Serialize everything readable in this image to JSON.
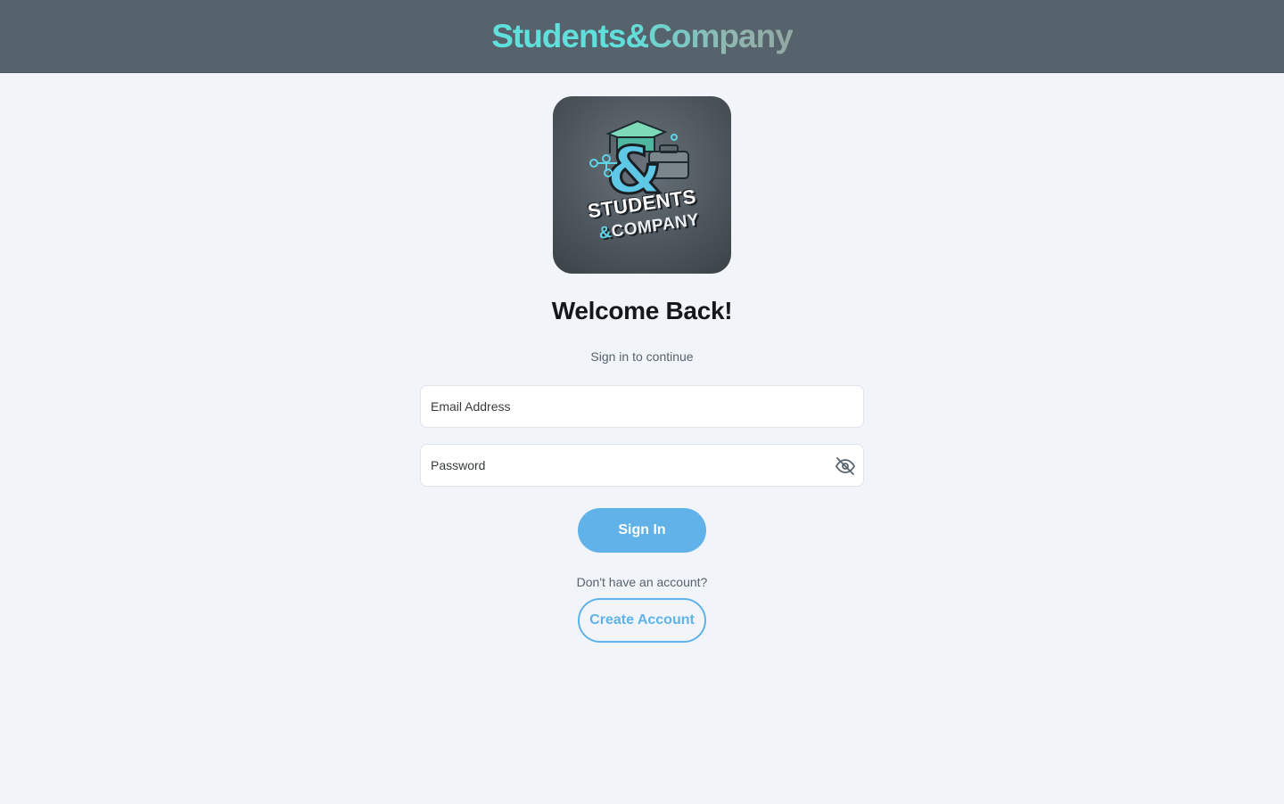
{
  "header": {
    "brand_part1": "Students",
    "brand_part2": "&Company"
  },
  "logo": {
    "line1": "STUDENTS",
    "line2_amp": "&",
    "line2_rest": "COMPANY"
  },
  "login": {
    "title": "Welcome Back!",
    "subtitle": "Sign in to continue",
    "email_placeholder": "Email Address",
    "password_placeholder": "Password",
    "visibility_icon": "eye-off-icon",
    "sign_in_label": "Sign In",
    "no_account_prompt": "Don't have an account?",
    "create_account_label": "Create Account"
  },
  "colors": {
    "header_bg": "#57636c",
    "page_bg": "#f1f4f8",
    "brand_accent": "#5fe0dc",
    "button_primary": "#60b2e8"
  }
}
